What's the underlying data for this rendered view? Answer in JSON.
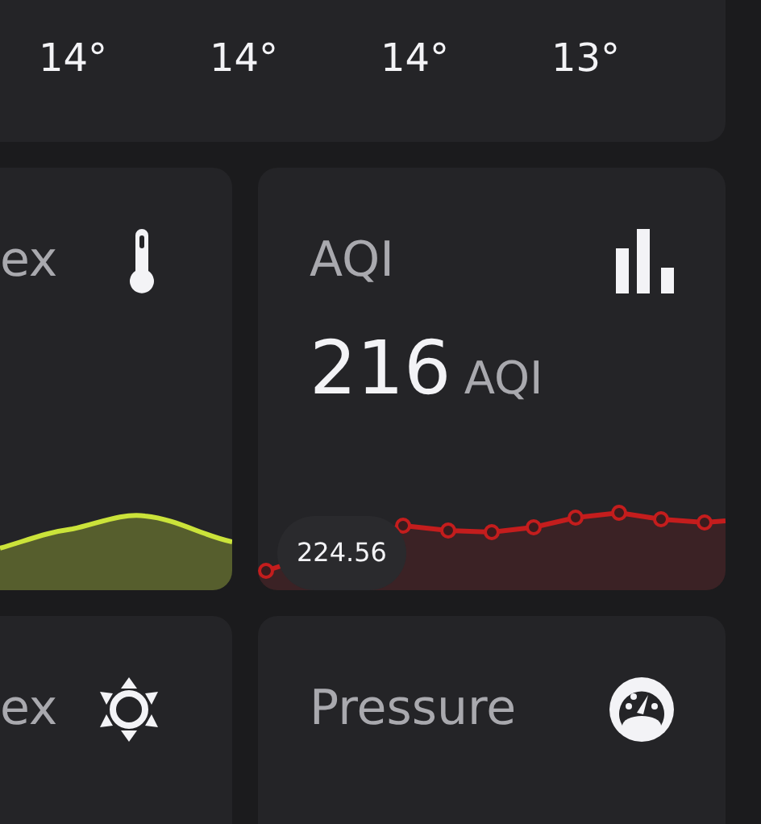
{
  "forecast": {
    "temperatures": [
      "14°",
      "14°",
      "14°",
      "13°"
    ]
  },
  "cards": [
    {
      "title": "ex",
      "chart": {
        "kind": "area",
        "color": "#cbe33a"
      }
    },
    {
      "title": "AQI",
      "value": "216",
      "unit": "AQI",
      "chart": {
        "kind": "dots",
        "color": "#c41d1d",
        "tooltip": "224.56"
      }
    },
    {
      "title": "ex"
    },
    {
      "title": "Pressure"
    }
  ]
}
